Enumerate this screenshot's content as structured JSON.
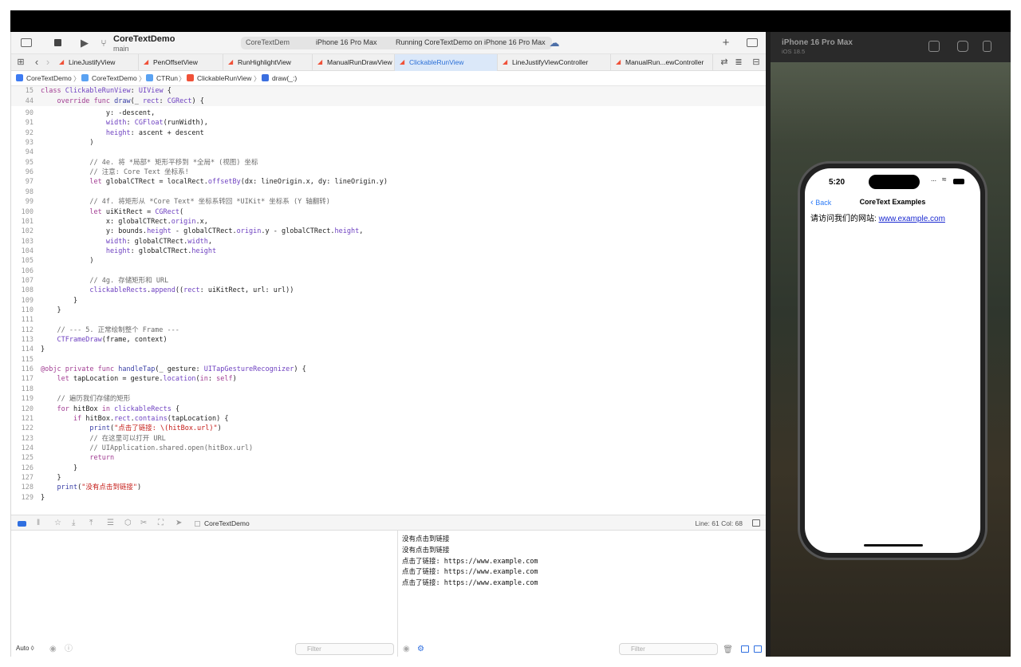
{
  "toolbar": {
    "project": "CoreTextDemo",
    "branch": "main",
    "scheme_target": "CoreTextDem",
    "device": "iPhone 16 Pro Max",
    "status": "Running CoreTextDemo on iPhone 16 Pro Max"
  },
  "tabs": [
    {
      "label": "LineJustifyView",
      "active": false
    },
    {
      "label": "PenOffsetView",
      "active": false
    },
    {
      "label": "RunHighlightView",
      "active": false
    },
    {
      "label": "ManualRunDrawView",
      "active": false
    },
    {
      "label": "ClickableRunView",
      "active": true
    },
    {
      "label": "LineJustifyViewController",
      "active": false
    },
    {
      "label": "ManualRun...ewController",
      "active": false
    }
  ],
  "jumpbar": [
    "CoreTextDemo",
    "CoreTextDemo",
    "CTRun",
    "ClickableRunView",
    "draw(_:)"
  ],
  "sticky_lines": [
    {
      "n": "15",
      "t": "class ClickableRunView: UIView {"
    },
    {
      "n": "44",
      "t": "    override func draw(_ rect: CGRect) {"
    }
  ],
  "code_lines": [
    {
      "n": "90",
      "t": "                y: -descent,"
    },
    {
      "n": "91",
      "t": "                width: CGFloat(runWidth),"
    },
    {
      "n": "92",
      "t": "                height: ascent + descent"
    },
    {
      "n": "93",
      "t": "            )"
    },
    {
      "n": "94",
      "t": ""
    },
    {
      "n": "95",
      "t": "            // 4e. 将 *局部* 矩形平移到 *全局* (视图) 坐标"
    },
    {
      "n": "96",
      "t": "            // 注意: Core Text 坐标系!"
    },
    {
      "n": "97",
      "t": "            let globalCTRect = localRect.offsetBy(dx: lineOrigin.x, dy: lineOrigin.y)"
    },
    {
      "n": "98",
      "t": ""
    },
    {
      "n": "99",
      "t": "            // 4f. 将矩形从 *Core Text* 坐标系转回 *UIKit* 坐标系 (Y 轴翻转)"
    },
    {
      "n": "100",
      "t": "            let uiKitRect = CGRect("
    },
    {
      "n": "101",
      "t": "                x: globalCTRect.origin.x,"
    },
    {
      "n": "102",
      "t": "                y: bounds.height - globalCTRect.origin.y - globalCTRect.height,"
    },
    {
      "n": "103",
      "t": "                width: globalCTRect.width,"
    },
    {
      "n": "104",
      "t": "                height: globalCTRect.height"
    },
    {
      "n": "105",
      "t": "            )"
    },
    {
      "n": "106",
      "t": ""
    },
    {
      "n": "107",
      "t": "            // 4g. 存储矩形和 URL"
    },
    {
      "n": "108",
      "t": "            clickableRects.append((rect: uiKitRect, url: url))"
    },
    {
      "n": "109",
      "t": "        }"
    },
    {
      "n": "110",
      "t": "    }"
    },
    {
      "n": "111",
      "t": ""
    },
    {
      "n": "112",
      "t": "    // --- 5. 正常绘制整个 Frame ---"
    },
    {
      "n": "113",
      "t": "    CTFrameDraw(frame, context)"
    },
    {
      "n": "114",
      "t": "}"
    },
    {
      "n": "115",
      "t": ""
    },
    {
      "n": "116",
      "t": "@objc private func handleTap(_ gesture: UITapGestureRecognizer) {"
    },
    {
      "n": "117",
      "t": "    let tapLocation = gesture.location(in: self)"
    },
    {
      "n": "118",
      "t": ""
    },
    {
      "n": "119",
      "t": "    // 遍历我们存储的矩形"
    },
    {
      "n": "120",
      "t": "    for hitBox in clickableRects {"
    },
    {
      "n": "121",
      "t": "        if hitBox.rect.contains(tapLocation) {"
    },
    {
      "n": "122",
      "t": "            print(\"点击了链接: \\(hitBox.url)\")"
    },
    {
      "n": "123",
      "t": "            // 在这里可以打开 URL"
    },
    {
      "n": "124",
      "t": "            // UIApplication.shared.open(hitBox.url)"
    },
    {
      "n": "125",
      "t": "            return"
    },
    {
      "n": "126",
      "t": "        }"
    },
    {
      "n": "127",
      "t": "    }"
    },
    {
      "n": "128",
      "t": "    print(\"没有点击到链接\")"
    },
    {
      "n": "129",
      "t": "}"
    }
  ],
  "debug": {
    "target": "CoreTextDemo",
    "line_col": "Line: 61  Col: 68",
    "auto_label": "Auto ◊",
    "filter_placeholder": "Filter"
  },
  "console_lines": [
    "没有点击到链接",
    "没有点击到链接",
    "点击了链接: https://www.example.com",
    "点击了链接: https://www.example.com",
    "点击了链接: https://www.example.com"
  ],
  "simulator": {
    "device": "iPhone 16 Pro Max",
    "os": "iOS 18.5",
    "time": "5:20",
    "back": "Back",
    "nav_title": "CoreText Examples",
    "content_prefix": "请访问我们的网站: ",
    "content_link": "www.example.com"
  }
}
